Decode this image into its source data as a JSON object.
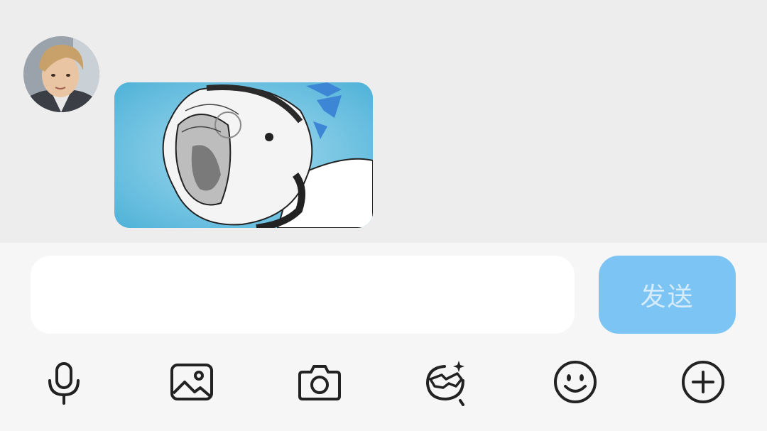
{
  "chat": {
    "messages": [
      {
        "sender": "contact",
        "avatar_icon": "user-avatar",
        "type": "sticker",
        "sticker_icon": "anime-character-sticker"
      }
    ]
  },
  "composer": {
    "input_value": "",
    "send_label": "发送"
  },
  "toolbar": {
    "icons": [
      "microphone-icon",
      "image-icon",
      "camera-icon",
      "sticker-face-icon",
      "emoji-icon",
      "plus-icon"
    ]
  },
  "colors": {
    "chat_background": "#ededed",
    "composer_background": "#f6f6f6",
    "send_button": "#7cc4f4",
    "send_text": "#d6ecfb",
    "icon_stroke": "#222222"
  }
}
